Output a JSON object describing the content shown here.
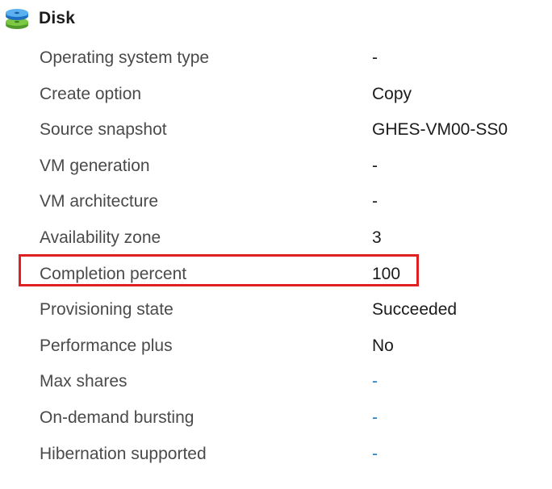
{
  "header": {
    "icon": "disk-icon",
    "title": "Disk"
  },
  "properties": [
    {
      "label": "Operating system type",
      "value": "-",
      "link": false
    },
    {
      "label": "Create option",
      "value": "Copy",
      "link": false
    },
    {
      "label": "Source snapshot",
      "value": "GHES-VM00-SS0",
      "link": false
    },
    {
      "label": "VM generation",
      "value": "-",
      "link": false
    },
    {
      "label": "VM architecture",
      "value": "-",
      "link": false
    },
    {
      "label": "Availability zone",
      "value": "3",
      "link": false
    },
    {
      "label": "Completion percent",
      "value": "100",
      "link": false
    },
    {
      "label": "Provisioning state",
      "value": "Succeeded",
      "link": false
    },
    {
      "label": "Performance plus",
      "value": "No",
      "link": false
    },
    {
      "label": "Max shares",
      "value": "-",
      "link": true
    },
    {
      "label": "On-demand bursting",
      "value": "-",
      "link": true
    },
    {
      "label": "Hibernation supported",
      "value": "-",
      "link": true
    }
  ],
  "highlight": {
    "target": "Completion percent",
    "color": "#e02020"
  },
  "colors": {
    "link": "#2a7bbd",
    "label": "#4a4a4a",
    "value": "#1b1b1b"
  }
}
